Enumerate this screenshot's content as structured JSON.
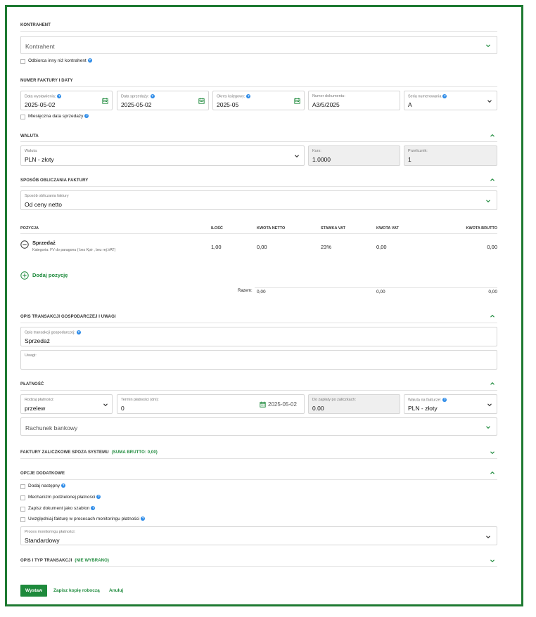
{
  "contractor": {
    "section_title": "KONTRAHENT",
    "select_placeholder": "Kontrahent",
    "other_recipient_label": "Odbiorca inny niż kontrahent"
  },
  "invoice_dates": {
    "section_title": "NUMER FAKTURY I DATY",
    "issue_date_label": "Data wystawienia:",
    "issue_date_value": "2025-05-02",
    "sale_date_label": "Data sprzedaży:",
    "sale_date_value": "2025-05-02",
    "period_label": "Okres księgowy:",
    "period_value": "2025-05",
    "doc_number_label": "Numer dokumentu:",
    "doc_number_value": "A3/5/2025",
    "series_label": "Seria numerowania",
    "series_value": "A",
    "monthly_date_label": "Miesięczna data sprzedaży"
  },
  "currency": {
    "section_title": "WALUTA",
    "currency_label": "Waluta:",
    "currency_value": "PLN - złoty",
    "rate_label": "Kurs:",
    "rate_value": "1.0000",
    "converter_label": "Przelicznik:",
    "converter_value": "1"
  },
  "calc_method": {
    "section_title": "SPOSÓB OBLICZANIA FAKTURY",
    "label": "Sposób obliczania faktury",
    "value": "Od ceny netto"
  },
  "positions": {
    "headers": {
      "item": "POZYCJA",
      "qty": "ILOŚĆ",
      "net": "KWOTA NETTO",
      "vat_rate": "STAWKA VAT",
      "vat": "KWOTA VAT",
      "gross": "KWOTA BRUTTO"
    },
    "rows": [
      {
        "name": "Sprzedaż",
        "category": "Kategoria: FV do paragonu ( bez Kpir , bez rej.VAT)",
        "qty": "1,00",
        "net": "0,00",
        "vat_rate": "23%",
        "vat": "0,00",
        "gross": "0,00"
      }
    ],
    "add_label": "Dodaj pozycję",
    "total_label": "Razem:",
    "total_net": "0,00",
    "total_vat": "0,00",
    "total_gross": "0,00"
  },
  "description": {
    "section_title": "OPIS TRANSAKCJI GOSPODARCZEJ I UWAGI",
    "transaction_label": "Opis transakcji gospodarczej:",
    "transaction_value": "Sprzedaż",
    "notes_label": "Uwagi:"
  },
  "payment": {
    "section_title": "PŁATNOŚĆ",
    "type_label": "Rodzaj płatności:",
    "type_value": "przelew",
    "term_label": "Termin płatności (dni):",
    "term_value": "0",
    "due_date": "2025-05-02",
    "to_pay_label": "Do zapłaty po zaliczkach:",
    "to_pay_value": "0.00",
    "invoice_currency_label": "Waluta na fakturze:",
    "invoice_currency_value": "PLN - złoty",
    "bank_account_placeholder": "Rachunek bankowy"
  },
  "advance_invoices": {
    "section_title": "FAKTURY ZALICZKOWE SPOZA SYSTEMU",
    "sum": "(SUMA BRUTTO: 0,00)"
  },
  "extra_options": {
    "section_title": "OPCJE DODATKOWE",
    "options": [
      "Dodaj następny",
      "Mechanizm podzielonej płatności",
      "Zapisz dokument jako szablon",
      "Uwzględniaj fakturę w procesach monitoringu płatności"
    ],
    "monitoring_label": "Proces monitoringu płatności:",
    "monitoring_value": "Standardowy"
  },
  "transaction_type": {
    "section_title": "OPIS I TYP TRANSAKCJI",
    "status": "(NIE WYBRANO)"
  },
  "actions": {
    "issue": "Wystaw",
    "save_draft": "Zapisz kopię roboczą",
    "cancel": "Anuluj"
  },
  "colors": {
    "accent": "#1e8a3c",
    "border": "#1e7a32",
    "help": "#2d8be8"
  }
}
